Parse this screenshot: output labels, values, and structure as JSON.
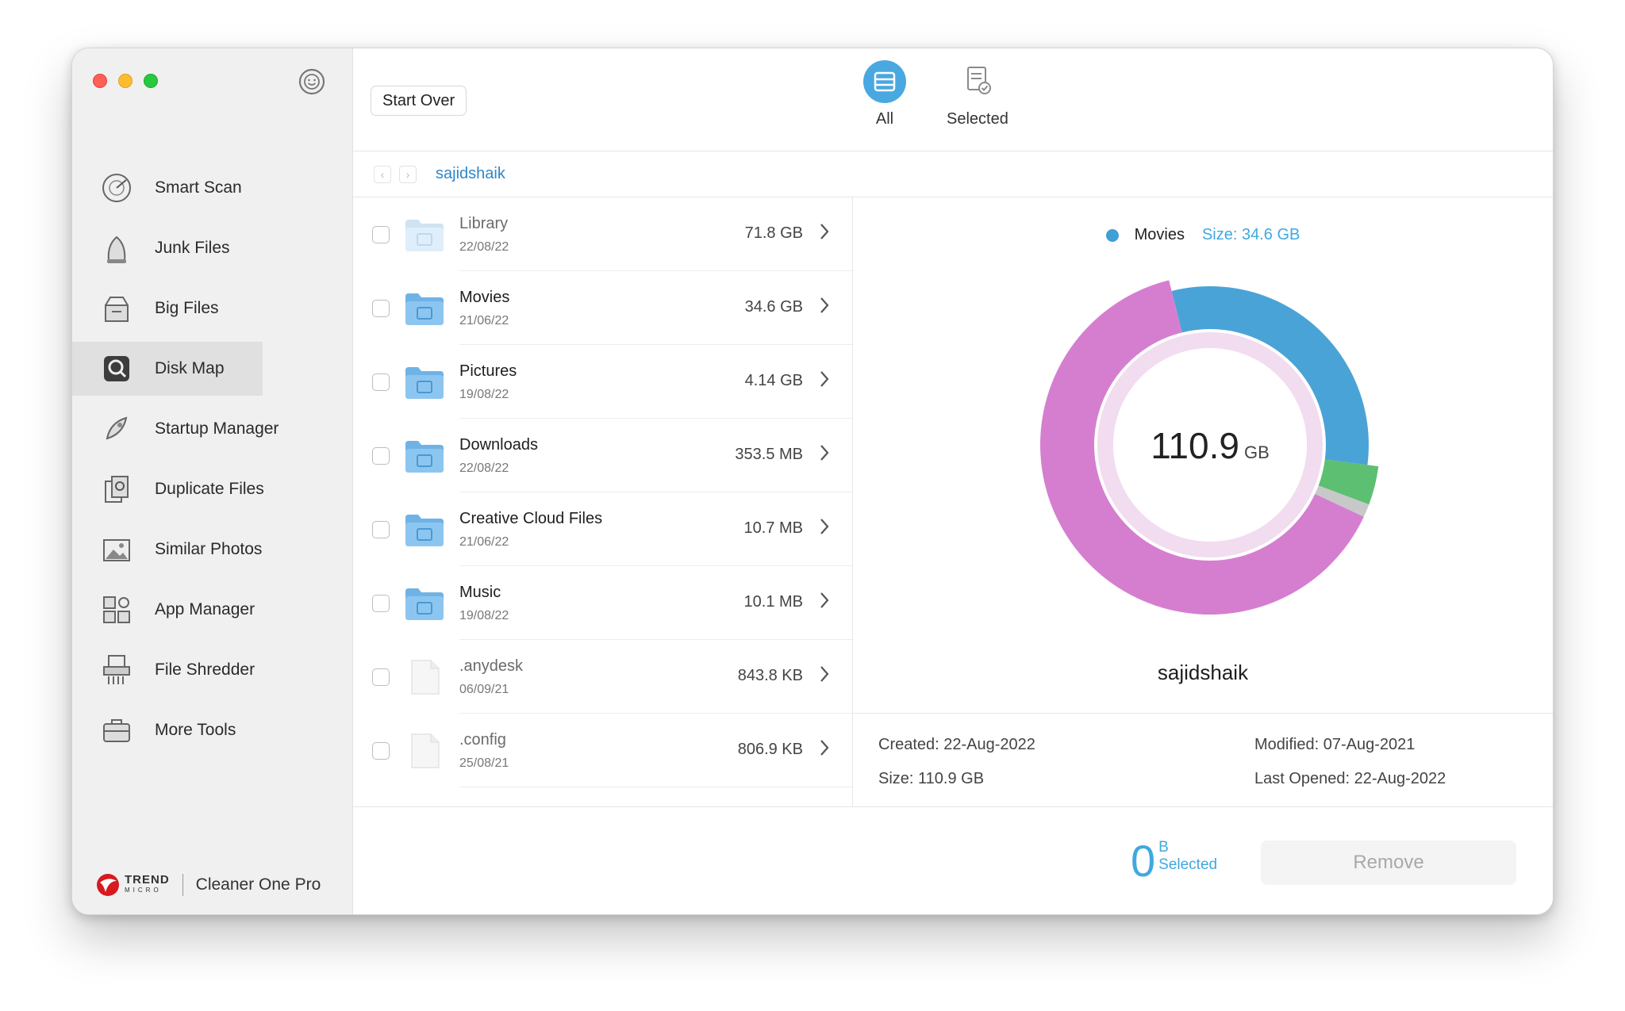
{
  "sidebar": {
    "items": [
      {
        "label": "Smart Scan",
        "icon": "radar-icon"
      },
      {
        "label": "Junk Files",
        "icon": "vacuum-icon"
      },
      {
        "label": "Big Files",
        "icon": "box-icon"
      },
      {
        "label": "Disk Map",
        "icon": "disk-map-icon"
      },
      {
        "label": "Startup Manager",
        "icon": "rocket-icon"
      },
      {
        "label": "Duplicate Files",
        "icon": "duplicate-icon"
      },
      {
        "label": "Similar Photos",
        "icon": "photo-icon"
      },
      {
        "label": "App Manager",
        "icon": "app-grid-icon"
      },
      {
        "label": "File Shredder",
        "icon": "shredder-icon"
      },
      {
        "label": "More Tools",
        "icon": "toolbox-icon"
      }
    ],
    "active_index": 3,
    "brand_name": "Cleaner One Pro",
    "brand_logo_text": "TREND",
    "brand_logo_sub": "MICRO"
  },
  "toolbar": {
    "start_over": "Start Over",
    "tab_all": "All",
    "tab_selected": "Selected"
  },
  "path": {
    "crumb": "sajidshaik"
  },
  "files": [
    {
      "name": "Library",
      "date": "22/08/22",
      "size": "71.8 GB",
      "type": "folder-light"
    },
    {
      "name": "Movies",
      "date": "21/06/22",
      "size": "34.6 GB",
      "type": "folder"
    },
    {
      "name": "Pictures",
      "date": "19/08/22",
      "size": "4.14 GB",
      "type": "folder"
    },
    {
      "name": "Downloads",
      "date": "22/08/22",
      "size": "353.5 MB",
      "type": "folder"
    },
    {
      "name": "Creative Cloud Files",
      "date": "21/06/22",
      "size": "10.7 MB",
      "type": "folder"
    },
    {
      "name": "Music",
      "date": "19/08/22",
      "size": "10.1 MB",
      "type": "folder"
    },
    {
      "name": ".anydesk",
      "date": "06/09/21",
      "size": "843.8 KB",
      "type": "file"
    },
    {
      "name": ".config",
      "date": "25/08/21",
      "size": "806.9 KB",
      "type": "file"
    }
  ],
  "detail": {
    "legend_name": "Movies",
    "legend_size": "Size: 34.6 GB",
    "total_value": "110.9",
    "total_unit": "GB",
    "folder_name": "sajidshaik",
    "created": "Created: 22-Aug-2022",
    "size": "Size: 110.9 GB",
    "modified": "Modified: 07-Aug-2021",
    "last_opened": "Last Opened: 22-Aug-2022",
    "segments": [
      {
        "name": "Movies",
        "gb": 34.6,
        "color": "#4aa3d6"
      },
      {
        "name": "Pictures",
        "gb": 4.14,
        "color": "#5dbf72"
      },
      {
        "name": "Other",
        "gb": 1.4,
        "color": "#c8c8c8"
      },
      {
        "name": "Library",
        "gb": 71.8,
        "color": "#d57ed0"
      }
    ]
  },
  "footer": {
    "selected_num": "0",
    "selected_unit": "B",
    "selected_label": "Selected",
    "remove": "Remove"
  },
  "colors": {
    "accent": "#3fa9e0",
    "folder_blue": "#5aa8e0",
    "donut_magenta": "#d57ed0",
    "donut_blue": "#4aa3d6"
  }
}
